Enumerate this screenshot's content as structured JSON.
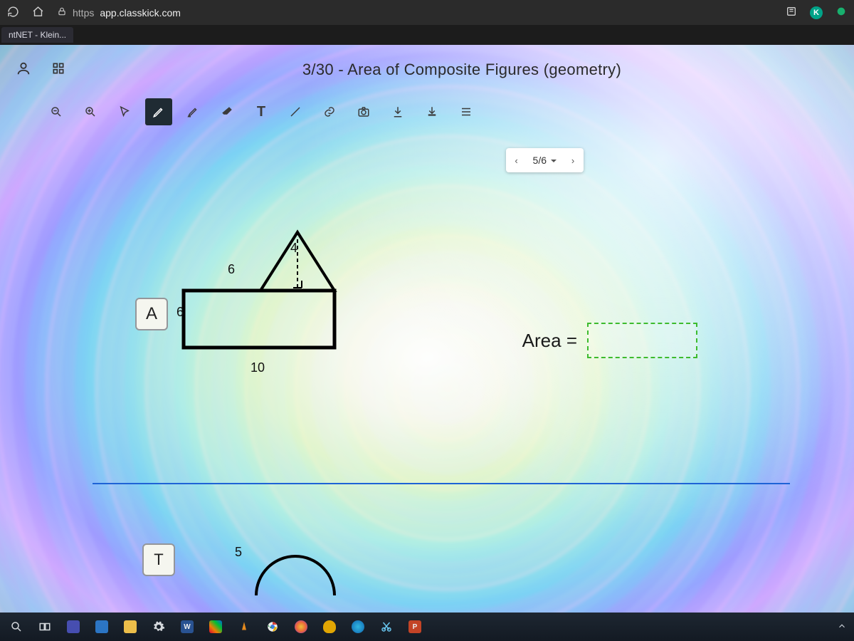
{
  "browser": {
    "protocol": "https",
    "host": "app.classkick.com",
    "tab_title": "ntNET - Klein...",
    "badge_letter": "K"
  },
  "header": {
    "assignment_title": "3/30 - Area of Composite Figures (geometry)"
  },
  "toolbar": {
    "tools": [
      "zoom-out",
      "zoom-in",
      "pointer",
      "pen",
      "highlighter",
      "eraser",
      "text",
      "line",
      "link",
      "camera",
      "import",
      "open-folder",
      "layers"
    ]
  },
  "pager": {
    "current": "5/6"
  },
  "problemA": {
    "label": "A",
    "dim_top_slant": "6",
    "dim_tri_height": "4",
    "dim_left": "6",
    "dim_bottom": "10"
  },
  "answer": {
    "label": "Area ="
  },
  "problemT": {
    "label": "T",
    "dim_left": "5"
  },
  "taskbar": {
    "items": [
      "search",
      "task-view",
      "teams",
      "file-explorer",
      "folder",
      "settings",
      "word",
      "tiles",
      "vlc",
      "chrome",
      "firefox",
      "onedrive",
      "edge",
      "snip",
      "powerpoint"
    ]
  }
}
